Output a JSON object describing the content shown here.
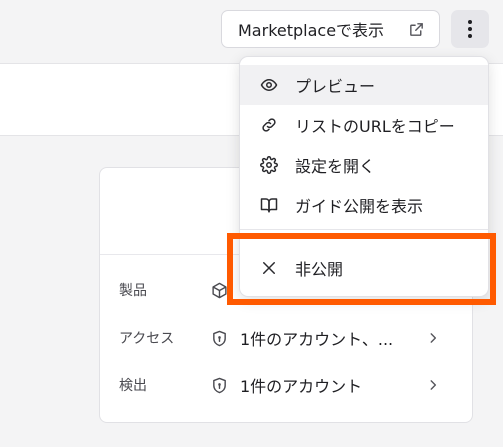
{
  "header": {
    "marketplace_button_label": "Marketplaceで表示",
    "marketplace_icon": "external-link-icon",
    "more_icon": "vertical-ellipsis-icon"
  },
  "menu": {
    "items": [
      {
        "label": "プレビュー",
        "icon": "eye-icon"
      },
      {
        "label": "リストのURLをコピー",
        "icon": "link-icon"
      },
      {
        "label": "設定を開く",
        "icon": "gear-icon"
      },
      {
        "label": "ガイド公開を表示",
        "icon": "book-icon"
      }
    ],
    "unpublish": {
      "label": "非公開",
      "icon": "close-icon"
    }
  },
  "details": {
    "rows": [
      {
        "label": "製品",
        "value": "",
        "icon": "cube-icon"
      },
      {
        "label": "アクセス",
        "value": "1件のアカウント、...",
        "icon": "shield-icon"
      },
      {
        "label": "検出",
        "value": "1件のアカウント",
        "icon": "shield-icon"
      }
    ]
  },
  "colors": {
    "highlight": "#ff5a00",
    "menu_hover": "#f1f1f3",
    "more_button_bg": "#e6e6ea"
  }
}
